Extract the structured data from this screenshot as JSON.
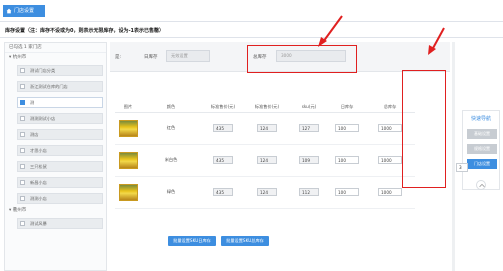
{
  "header": {
    "tab_label": "门店设置"
  },
  "notice": "库存设置（注：库存不设或为0，则表示无限库存，设为-1表示已售罄）",
  "tree": {
    "head": "已勾选 1 家门店",
    "groups": [
      {
        "label": "杭州市",
        "items": [
          "测试门店分类",
          "浙江测试仓库的门店",
          "测",
          "测测测试小店",
          "测店",
          "才思小店",
          "三只松鼠",
          "新昌小店",
          "测测小店"
        ]
      },
      {
        "label": "衢州市",
        "items": [
          "测试风暴"
        ]
      }
    ]
  },
  "filter": {
    "label_hint": "是:",
    "daily_label": "日库存",
    "daily_placeholder": "无效设置",
    "total_label": "总库存",
    "total_value": "3000"
  },
  "table": {
    "headers": [
      "图片",
      "颜色",
      "标准售价(元)",
      "标准售价(元)",
      "sku(元)",
      "日库存",
      "总库存"
    ],
    "rows": [
      {
        "color": "红色",
        "p1": "435",
        "p2": "124",
        "sku": "127",
        "daily": "100",
        "total": "1000"
      },
      {
        "color": "米白色",
        "p1": "435",
        "p2": "124",
        "sku": "109",
        "daily": "100",
        "total": "1000"
      },
      {
        "color": "绿色",
        "p1": "435",
        "p2": "124",
        "sku": "112",
        "daily": "100",
        "total": "1000"
      }
    ]
  },
  "buttons": {
    "batch_daily": "批量设置SKU日库存",
    "batch_total": "批量设置SKU总库存"
  },
  "quick_nav": {
    "title": "快速导航",
    "items": [
      "基础设置",
      "规格设置",
      "门店设置"
    ]
  },
  "side_value": "3",
  "colors": {
    "accent": "#3d8ee0",
    "highlight": "#e02020"
  }
}
